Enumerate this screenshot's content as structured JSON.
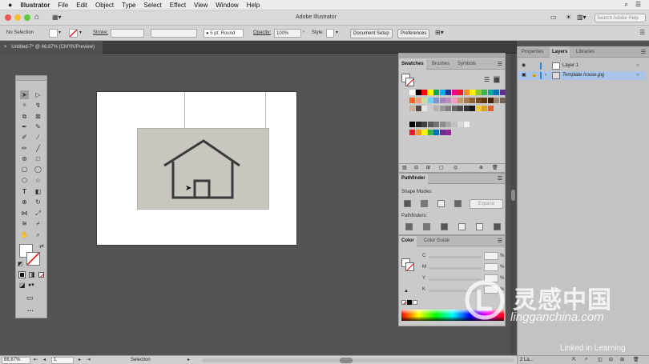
{
  "menubar": {
    "app": "Illustrator",
    "items": [
      "File",
      "Edit",
      "Object",
      "Type",
      "Select",
      "Effect",
      "View",
      "Window",
      "Help"
    ]
  },
  "titlebar": {
    "title": "Adobe Illustrator",
    "search_placeholder": "Search Adobe Help"
  },
  "control_bar": {
    "selection_label": "No Selection",
    "stroke_label": "Stroke:",
    "brush_value": "5 pt. Round",
    "opacity_label": "Opacity:",
    "opacity_value": "100%",
    "style_label": "Style:",
    "doc_setup_button": "Document Setup",
    "preferences_button": "Preferences"
  },
  "document_tab": {
    "label": "Untitled-7* @ 66,67% (CMYK/Preview)",
    "close": "×"
  },
  "swatches_panel": {
    "tabs": [
      "Swatches",
      "Brushes",
      "Symbols"
    ]
  },
  "pathfinder_panel": {
    "tab": "Pathfinder",
    "shape_modes_label": "Shape Modes:",
    "pathfinders_label": "Pathfinders:",
    "expand_button": "Expand"
  },
  "color_panel": {
    "tabs": [
      "Color",
      "Color Guide"
    ],
    "channels": [
      "C",
      "M",
      "Y",
      "K"
    ],
    "percent": "%"
  },
  "right_panel": {
    "tabs": [
      "Properties",
      "Layers",
      "Libraries"
    ],
    "layers": [
      {
        "name": "Layer 1"
      },
      {
        "name": "Template house.jpg"
      }
    ],
    "footer_count": "2 La..."
  },
  "status_bar": {
    "zoom": "66,67%",
    "artboard_number": "1",
    "tool_name": "Selection"
  },
  "watermark": {
    "brand_cn": "灵感中国",
    "domain": "lingganchina.com",
    "linkedin": "Linked in Learning"
  },
  "colors": {
    "accent_blue": "#2e86d6",
    "layer_highlight": "#a9c4e6"
  }
}
